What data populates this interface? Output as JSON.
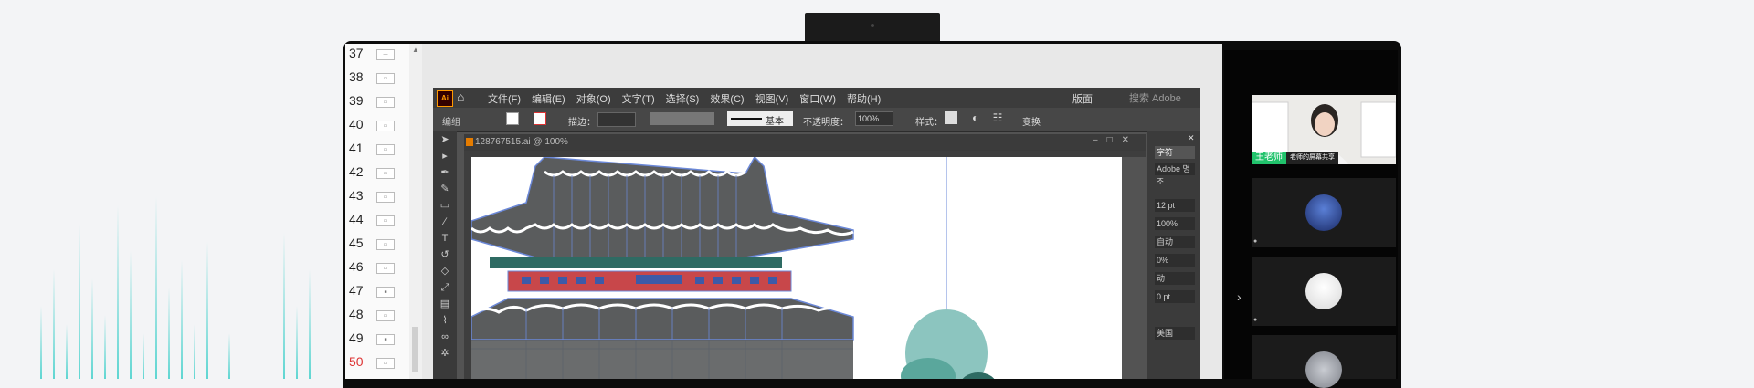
{
  "slides": [
    {
      "num": "37",
      "thumb": "—"
    },
    {
      "num": "38",
      "thumb": "▭"
    },
    {
      "num": "39",
      "thumb": "▭"
    },
    {
      "num": "40",
      "thumb": "▭"
    },
    {
      "num": "41",
      "thumb": "▭"
    },
    {
      "num": "42",
      "thumb": "▭"
    },
    {
      "num": "43",
      "thumb": "▭"
    },
    {
      "num": "44",
      "thumb": "▭"
    },
    {
      "num": "45",
      "thumb": "▭"
    },
    {
      "num": "46",
      "thumb": "▭"
    },
    {
      "num": "47",
      "thumb": "■"
    },
    {
      "num": "48",
      "thumb": "▭"
    },
    {
      "num": "49",
      "thumb": "■"
    },
    {
      "num": "50",
      "thumb": "▭"
    }
  ],
  "ai": {
    "logo": "Ai",
    "menu": [
      "文件(F)",
      "编辑(E)",
      "对象(O)",
      "文字(T)",
      "选择(S)",
      "效果(C)",
      "视图(V)",
      "窗口(W)",
      "帮助(H)"
    ],
    "layout_label": "版面",
    "search_placeholder": "搜索 Adobe",
    "control": {
      "selection_label": "编组",
      "stroke_label": "描边：",
      "stroke_style": "基本",
      "opacity_label": "不透明度：",
      "opacity_value": "100%",
      "style_label": "样式：",
      "transform_label": "变换"
    },
    "document_title": "128767515.ai @ 100%",
    "panel": {
      "tab": "字符",
      "font": "Adobe 명조",
      "size": "12 pt",
      "scale": "100%",
      "leading": "自动",
      "tracking": "0%",
      "kerning": "动",
      "baseline": "0 pt",
      "language": "美国"
    }
  },
  "colors": {
    "roof": "#5a5c5d",
    "roof_outline": "#6b88d8",
    "pillar_red": "#c8474a",
    "window_blue": "#3d5aa8",
    "trim_teal": "#2e6b63",
    "tree_teal": "#8cc5bf",
    "teacher_green": "#21c36c",
    "bar_cyan": "#5fd6d2"
  },
  "sidebar": {
    "teacher_name": "王老师",
    "teacher_status": "老师的屏幕共享",
    "expand_icon": "›"
  }
}
